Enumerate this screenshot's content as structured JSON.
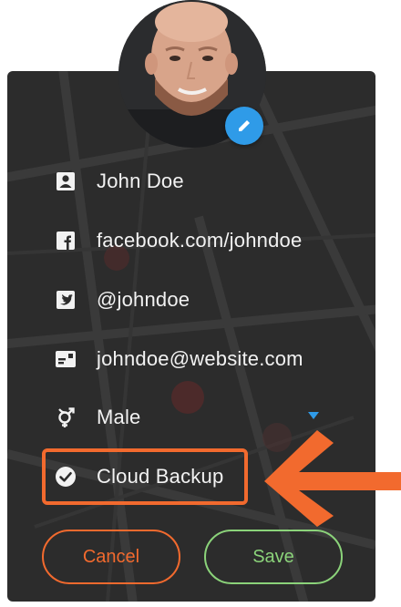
{
  "profile": {
    "avatar_alt": "profile photo",
    "edit_icon": "pencil-icon"
  },
  "fields": {
    "name": {
      "icon": "person-card-icon",
      "value": "John Doe"
    },
    "facebook": {
      "icon": "facebook-icon",
      "value": "facebook.com/johndoe"
    },
    "twitter": {
      "icon": "twitter-icon",
      "value": "@johndoe"
    },
    "email": {
      "icon": "contact-card-icon",
      "value": "johndoe@website.com"
    },
    "gender": {
      "icon": "gender-icon",
      "value": "Male"
    },
    "cloud_backup": {
      "icon": "checkmark-circle-icon",
      "label": "Cloud Backup",
      "checked": true
    }
  },
  "actions": {
    "cancel_label": "Cancel",
    "save_label": "Save"
  },
  "colors": {
    "card_bg": "#2c2c2c",
    "accent_blue": "#2f9be8",
    "highlight_orange": "#f26a2e",
    "save_green": "#8bd37a",
    "text": "#f2f2f2"
  }
}
